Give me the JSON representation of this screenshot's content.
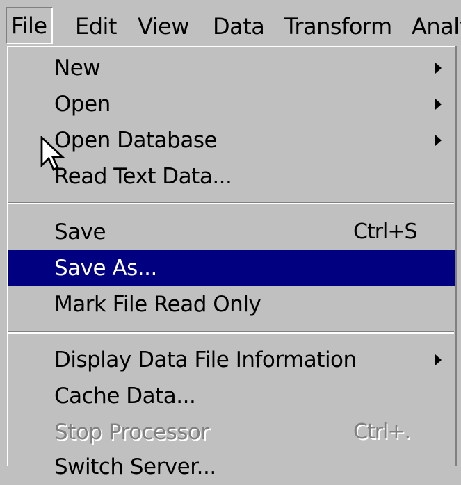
{
  "menubar": {
    "items": [
      {
        "label": "File",
        "active": true
      },
      {
        "label": "Edit"
      },
      {
        "label": "View"
      },
      {
        "label": "Data"
      },
      {
        "label": "Transform"
      },
      {
        "label": "Analy"
      }
    ]
  },
  "file_menu": {
    "items": [
      {
        "label": "New",
        "submenu": true
      },
      {
        "label": "Open",
        "submenu": true
      },
      {
        "label": "Open Database",
        "submenu": true
      },
      {
        "label": "Read Text Data..."
      },
      {
        "label": "Save",
        "shortcut": "Ctrl+S"
      },
      {
        "label": "Save As...",
        "highlighted": true
      },
      {
        "label": "Mark File Read Only"
      },
      {
        "label": "Display Data File Information",
        "submenu": true
      },
      {
        "label": "Cache Data..."
      },
      {
        "label": "Stop Processor",
        "shortcut": "Ctrl+.",
        "disabled": true
      },
      {
        "label": "Switch Server..."
      }
    ]
  },
  "colors": {
    "menu_bg": "#c0c0c0",
    "highlight_bg": "#000080",
    "disabled_text": "#808080"
  },
  "icons": {
    "cursor": "arrow-cursor-icon",
    "submenu": "submenu-arrow-icon"
  }
}
